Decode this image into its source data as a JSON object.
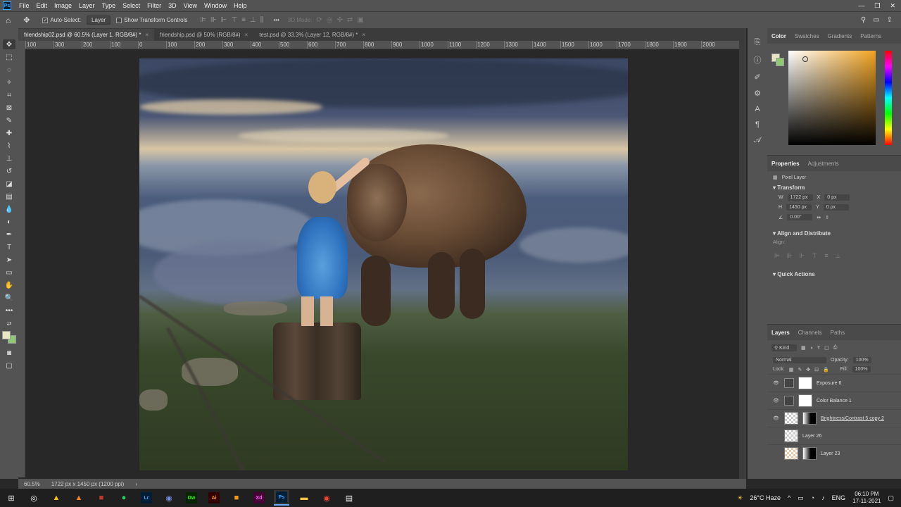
{
  "menubar": {
    "items": [
      "File",
      "Edit",
      "Image",
      "Layer",
      "Type",
      "Select",
      "Filter",
      "3D",
      "View",
      "Window",
      "Help"
    ]
  },
  "options": {
    "auto_select_label": "Auto-Select:",
    "auto_select_target": "Layer",
    "show_transform_label": "Show Transform Controls",
    "three_d_mode_label": "3D Mode:"
  },
  "tabs": [
    {
      "label": "friendship02.psd @ 60.5% (Layer 1, RGB/8#) *",
      "active": true
    },
    {
      "label": "friendship.psd @ 50% (RGB/8#)",
      "active": false
    },
    {
      "label": "test.psd @ 33.3% (Layer 12, RGB/8#) *",
      "active": false
    }
  ],
  "ruler": {
    "ticks": [
      "100",
      "300",
      "200",
      "100",
      "0",
      "100",
      "200",
      "300",
      "400",
      "500",
      "600",
      "700",
      "800",
      "900",
      "1000",
      "1100",
      "1200",
      "1300",
      "1400",
      "1500",
      "1600",
      "1700",
      "1800",
      "1900",
      "2000",
      "2"
    ]
  },
  "status": {
    "zoom": "60.5%",
    "doc_size": "1722 px x 1450 px (1200 ppi)"
  },
  "color_panel": {
    "tabs": [
      "Color",
      "Swatches",
      "Gradients",
      "Patterns"
    ],
    "foreground_color": "#e9e6c3",
    "background_color": "#90c874"
  },
  "properties": {
    "tabs": [
      "Properties",
      "Adjustments"
    ],
    "layer_type": "Pixel Layer",
    "transform_label": "Transform",
    "w_label": "W",
    "w_value": "1722 px",
    "h_label": "H",
    "h_value": "1450 px",
    "x_label": "X",
    "x_value": "0 px",
    "y_label": "Y",
    "y_value": "0 px",
    "angle_value": "0.00°",
    "align_section": "Align and Distribute",
    "align_label": "Align:",
    "quick_actions": "Quick Actions"
  },
  "layers_panel": {
    "tabs": [
      "Layers",
      "Channels",
      "Paths"
    ],
    "kind_label": "Kind",
    "blend_mode": "Normal",
    "opacity_label": "Opacity:",
    "opacity_value": "100%",
    "lock_label": "Lock:",
    "fill_label": "Fill:",
    "fill_value": "100%",
    "layers": [
      {
        "name": "Exposure 6",
        "visible": true
      },
      {
        "name": "Color Balance 1",
        "visible": true
      },
      {
        "name": "Brightness/Contrast 5 copy 2",
        "visible": true
      },
      {
        "name": "Layer 26",
        "visible": false
      },
      {
        "name": "Layer 23",
        "visible": false
      }
    ]
  },
  "taskbar": {
    "weather": "26°C Haze",
    "language": "ENG",
    "time": "06:10 PM",
    "date": "17-11-2021",
    "apps": [
      "Lr",
      "Dw",
      "Ai",
      "Xd",
      "Ps"
    ]
  }
}
